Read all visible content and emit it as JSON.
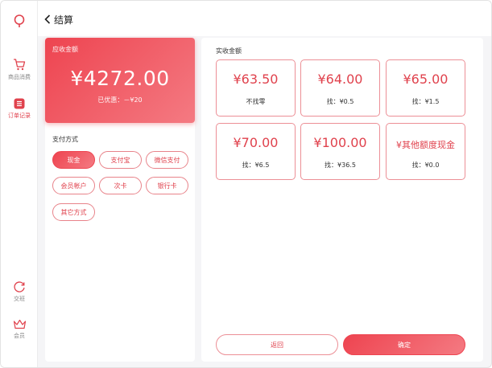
{
  "header": {
    "title": "结算"
  },
  "sidebar": {
    "items": [
      {
        "label": "商品消费",
        "icon": "cart-icon"
      },
      {
        "label": "订单记录",
        "icon": "order-list-icon"
      },
      {
        "label": "交班",
        "icon": "shift-icon"
      },
      {
        "label": "会员",
        "icon": "crown-icon"
      }
    ]
  },
  "receivable": {
    "label": "应收金额",
    "amount": "¥4272.00",
    "discount": "已优惠：－¥20"
  },
  "payment": {
    "title": "支付方式",
    "methods": [
      "现金",
      "支付宝",
      "微信支付",
      "会员帐户",
      "次卡",
      "银行卡",
      "其它方式"
    ],
    "selected": "现金"
  },
  "received": {
    "title": "实收金额",
    "options": [
      {
        "amount": "¥63.50",
        "change": "不找零"
      },
      {
        "amount": "¥64.00",
        "change": "找：¥0.5"
      },
      {
        "amount": "¥65.00",
        "change": "找：¥1.5"
      },
      {
        "amount": "¥70.00",
        "change": "找：¥6.5"
      },
      {
        "amount": "¥100.00",
        "change": "找：¥36.5"
      },
      {
        "amount": "¥其他额度现金",
        "change": "找：¥0.0"
      }
    ]
  },
  "actions": {
    "return_label": "返回",
    "confirm_label": "确定"
  },
  "colors": {
    "accent": "#e0424d",
    "gradient_start": "#ee4450",
    "gradient_end": "#f47a82"
  }
}
